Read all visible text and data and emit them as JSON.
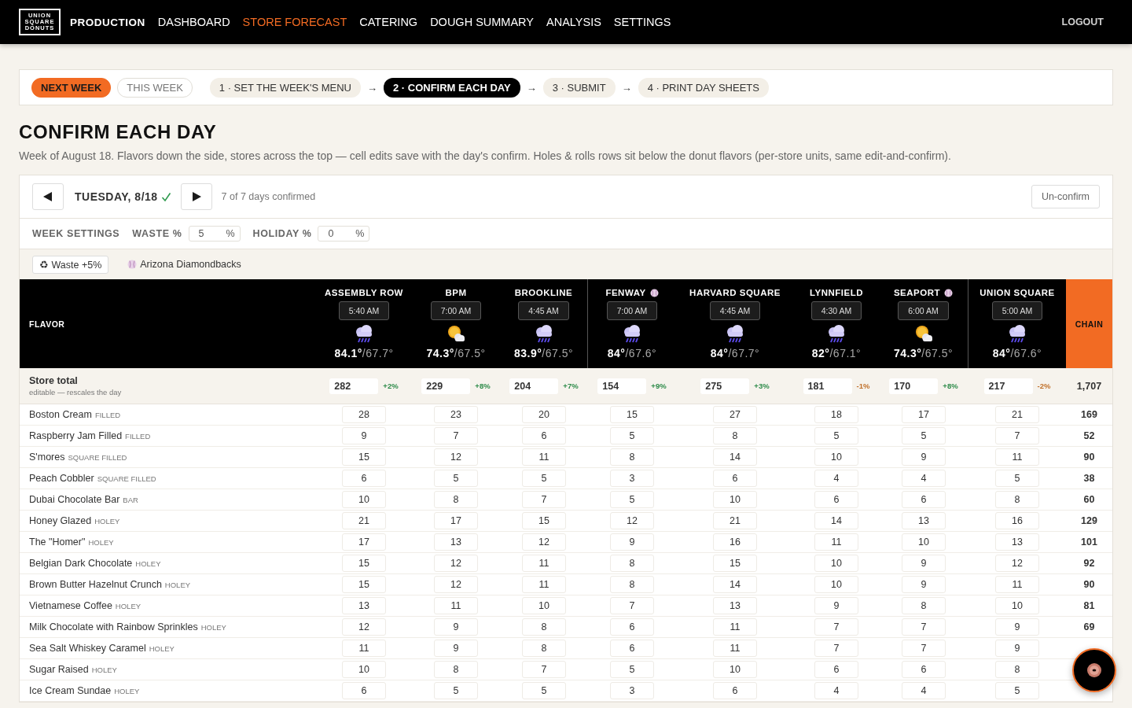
{
  "nav": {
    "logo_lines": [
      "UNION",
      "SQUARE",
      "DONUTS"
    ],
    "section": "PRODUCTION",
    "items": [
      {
        "label": "DASHBOARD",
        "selected": false
      },
      {
        "label": "STORE FORECAST",
        "selected": true
      },
      {
        "label": "CATERING",
        "selected": false
      },
      {
        "label": "DOUGH SUMMARY",
        "selected": false
      },
      {
        "label": "ANALYSIS",
        "selected": false
      },
      {
        "label": "SETTINGS",
        "selected": false
      }
    ],
    "logout": "LOGOUT"
  },
  "week_toggle": [
    {
      "label": "NEXT WEEK",
      "selected": true
    },
    {
      "label": "THIS WEEK",
      "selected": false
    }
  ],
  "steps": [
    {
      "label": "1 · SET THE WEEK'S MENU",
      "selected": false
    },
    {
      "label": "2 · CONFIRM EACH DAY",
      "selected": true
    },
    {
      "label": "3 · SUBMIT",
      "selected": false
    },
    {
      "label": "4 · PRINT DAY SHEETS",
      "selected": false
    }
  ],
  "step_arrows": [
    "→",
    "→",
    "→"
  ],
  "title": "CONFIRM EACH DAY",
  "description": "Week of August 18. Flavors down the side, stores across the top — cell edits save with the day's confirm. Holes & rolls rows sit below the donut flavors (per-store units, same edit-and-confirm).",
  "day": {
    "label": "TUESDAY, 8/18",
    "confirmed": true,
    "status": "7 of 7 days confirmed",
    "unconfirm": "Un-confirm"
  },
  "week_settings": {
    "label": "WEEK SETTINGS",
    "fields": [
      {
        "label": "WASTE %",
        "value": "5",
        "unit": "%"
      },
      {
        "label": "HOLIDAY %",
        "value": "0",
        "unit": "%"
      }
    ]
  },
  "tags": [
    {
      "kind": "chip",
      "label": "♻ Waste +5%"
    },
    {
      "kind": "game",
      "label": "Arizona Diamondbacks"
    }
  ],
  "table": {
    "flavor_heading": "FLAVOR",
    "chain_heading": "CHAIN",
    "stores": [
      {
        "name": "ASSEMBLY ROW",
        "game": false,
        "group_end": false,
        "time": "5:40 AM",
        "sunny": false,
        "high": "84.1°",
        "low": "/67.7°",
        "total": "282",
        "change": "+2%",
        "falling": false
      },
      {
        "name": "BPM",
        "game": false,
        "group_end": false,
        "time": "7:00 AM",
        "sunny": true,
        "high": "74.3°",
        "low": "/67.5°",
        "total": "229",
        "change": "+8%",
        "falling": false
      },
      {
        "name": "BROOKLINE",
        "game": false,
        "group_end": true,
        "time": "4:45 AM",
        "sunny": false,
        "high": "83.9°",
        "low": "/67.5°",
        "total": "204",
        "change": "+7%",
        "falling": false
      },
      {
        "name": "FENWAY",
        "game": true,
        "group_end": false,
        "time": "7:00 AM",
        "sunny": false,
        "high": "84°",
        "low": "/67.6°",
        "total": "154",
        "change": "+9%",
        "falling": false
      },
      {
        "name": "HARVARD SQUARE",
        "game": false,
        "group_end": false,
        "time": "4:45 AM",
        "sunny": false,
        "high": "84°",
        "low": "/67.7°",
        "total": "275",
        "change": "+3%",
        "falling": false
      },
      {
        "name": "LYNNFIELD",
        "game": false,
        "group_end": false,
        "time": "4:30 AM",
        "sunny": false,
        "high": "82°",
        "low": "/67.1°",
        "total": "181",
        "change": "-1%",
        "falling": true
      },
      {
        "name": "SEAPORT",
        "game": true,
        "group_end": true,
        "time": "6:00 AM",
        "sunny": true,
        "high": "74.3°",
        "low": "/67.5°",
        "total": "170",
        "change": "+8%",
        "falling": false
      },
      {
        "name": "UNION SQUARE",
        "game": false,
        "group_end": false,
        "time": "5:00 AM",
        "sunny": false,
        "high": "84°",
        "low": "/67.6°",
        "total": "217",
        "change": "-2%",
        "falling": true
      }
    ],
    "total_row": {
      "label": "Store total",
      "hint": "editable — rescales the day",
      "chain": "1,707"
    },
    "rows": [
      {
        "flavor": "Boston Cream",
        "category": "FILLED",
        "counts": [
          "28",
          "23",
          "20",
          "15",
          "27",
          "18",
          "17",
          "21"
        ],
        "chain": "169"
      },
      {
        "flavor": "Raspberry Jam Filled",
        "category": "FILLED",
        "counts": [
          "9",
          "7",
          "6",
          "5",
          "8",
          "5",
          "5",
          "7"
        ],
        "chain": "52"
      },
      {
        "flavor": "S'mores",
        "category": "SQUARE FILLED",
        "counts": [
          "15",
          "12",
          "11",
          "8",
          "14",
          "10",
          "9",
          "11"
        ],
        "chain": "90"
      },
      {
        "flavor": "Peach Cobbler",
        "category": "SQUARE FILLED",
        "counts": [
          "6",
          "5",
          "5",
          "3",
          "6",
          "4",
          "4",
          "5"
        ],
        "chain": "38"
      },
      {
        "flavor": "Dubai Chocolate Bar",
        "category": "BAR",
        "counts": [
          "10",
          "8",
          "7",
          "5",
          "10",
          "6",
          "6",
          "8"
        ],
        "chain": "60"
      },
      {
        "flavor": "Honey Glazed",
        "category": "HOLEY",
        "counts": [
          "21",
          "17",
          "15",
          "12",
          "21",
          "14",
          "13",
          "16"
        ],
        "chain": "129"
      },
      {
        "flavor": "The \"Homer\"",
        "category": "HOLEY",
        "counts": [
          "17",
          "13",
          "12",
          "9",
          "16",
          "11",
          "10",
          "13"
        ],
        "chain": "101"
      },
      {
        "flavor": "Belgian Dark Chocolate",
        "category": "HOLEY",
        "counts": [
          "15",
          "12",
          "11",
          "8",
          "15",
          "10",
          "9",
          "12"
        ],
        "chain": "92"
      },
      {
        "flavor": "Brown Butter Hazelnut Crunch",
        "category": "HOLEY",
        "counts": [
          "15",
          "12",
          "11",
          "8",
          "14",
          "10",
          "9",
          "11"
        ],
        "chain": "90"
      },
      {
        "flavor": "Vietnamese Coffee",
        "category": "HOLEY",
        "counts": [
          "13",
          "11",
          "10",
          "7",
          "13",
          "9",
          "8",
          "10"
        ],
        "chain": "81"
      },
      {
        "flavor": "Milk Chocolate with Rainbow Sprinkles",
        "category": "HOLEY",
        "counts": [
          "12",
          "9",
          "8",
          "6",
          "11",
          "7",
          "7",
          "9"
        ],
        "chain": "69"
      },
      {
        "flavor": "Sea Salt Whiskey Caramel",
        "category": "HOLEY",
        "counts": [
          "11",
          "9",
          "8",
          "6",
          "11",
          "7",
          "7",
          "9"
        ]
      },
      {
        "flavor": "Sugar Raised",
        "category": "HOLEY",
        "counts": [
          "10",
          "8",
          "7",
          "5",
          "10",
          "6",
          "6",
          "8"
        ]
      },
      {
        "flavor": "Ice Cream Sundae",
        "category": "HOLEY",
        "counts": [
          "6",
          "5",
          "5",
          "3",
          "6",
          "4",
          "4",
          "5"
        ]
      }
    ]
  }
}
